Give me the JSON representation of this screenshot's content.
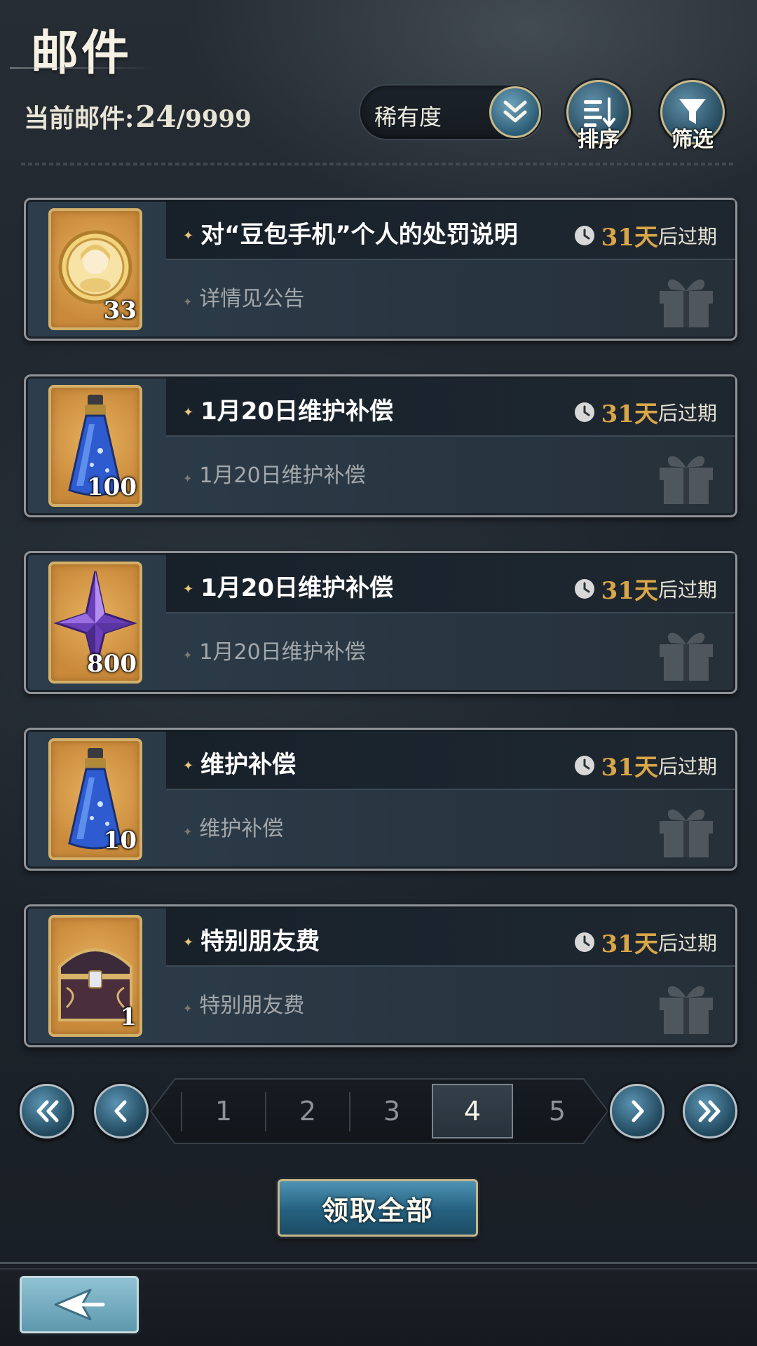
{
  "header": {
    "title": "邮件",
    "mail_count_label": "当前邮件:",
    "mail_count_current": "24",
    "mail_count_max": "/9999",
    "sort_dropdown": {
      "selected": "稀有度",
      "icon": "double-chevron-down-icon"
    },
    "sort_button": {
      "label": "排序",
      "icon": "sort-list-icon"
    },
    "filter_button": {
      "label": "筛选",
      "icon": "funnel-icon"
    }
  },
  "mails": [
    {
      "title": "对“豆包手机”个人的处罚说明",
      "description": "详情见公告",
      "days": "31天",
      "suffix": "后过期",
      "item_icon": "gold-coin-icon",
      "quantity": "33"
    },
    {
      "title": "1月20日维护补偿",
      "description": "1月20日维护补偿",
      "days": "31天",
      "suffix": "后过期",
      "item_icon": "blue-potion-icon",
      "quantity": "100"
    },
    {
      "title": "1月20日维护补偿",
      "description": "1月20日维护补偿",
      "days": "31天",
      "suffix": "后过期",
      "item_icon": "purple-crystal-star-icon",
      "quantity": "800"
    },
    {
      "title": "维护补偿",
      "description": "维护补偿",
      "days": "31天",
      "suffix": "后过期",
      "item_icon": "blue-potion-icon",
      "quantity": "10"
    },
    {
      "title": "特别朋友费",
      "description": "特别朋友费",
      "days": "31天",
      "suffix": "后过期",
      "item_icon": "treasure-chest-icon",
      "quantity": "1"
    }
  ],
  "pagination": {
    "pages": [
      "1",
      "2",
      "3",
      "4",
      "5"
    ],
    "current_page": "4"
  },
  "claim_all_label": "领取全部",
  "colors": {
    "accent_gold": "#d9a648",
    "button_blue": "#25617f",
    "frame_gold": "#c7b68a"
  }
}
